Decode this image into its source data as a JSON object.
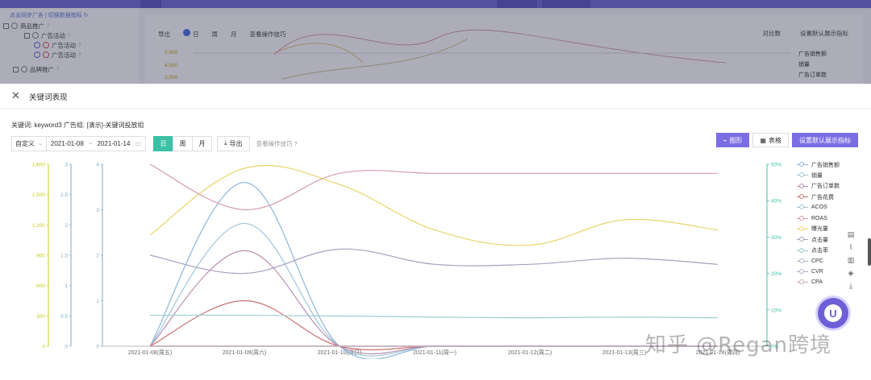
{
  "background": {
    "left_hint": "点击同步广告 | 切换数据指标 ↻",
    "tree": [
      {
        "label": "商品推广",
        "indent": 0
      },
      {
        "label": "广告活动",
        "indent": 1
      },
      {
        "label": "广告活动",
        "indent": 2
      },
      {
        "label": "广告活动",
        "indent": 2
      },
      {
        "label": "品牌推广",
        "indent": 0
      }
    ],
    "tools": {
      "export": "导出",
      "day": "日",
      "week": "周",
      "month": "月",
      "tip": "查看操作技巧"
    },
    "right": {
      "compare": "对比数",
      "set_default": "设置默认展示指标"
    },
    "legend": [
      "广告销售额",
      "销量",
      "广告订单数"
    ],
    "y_values": [
      "5,000",
      "4,000",
      "3,000"
    ]
  },
  "modal": {
    "title": "关键词表现",
    "subtitle": "关键词: keyword3  广告组: [演示]-关键词投放组",
    "range_preset": "自定义",
    "date_start": "2021-01-08",
    "date_sep": "~",
    "date_end": "2021-01-14",
    "seg_day": "日",
    "seg_week": "周",
    "seg_month": "月",
    "export": "导出",
    "op_tip": "查看操作技巧",
    "btn_graph": "图形",
    "btn_table": "表格",
    "btn_set_default": "设置默认展示指标"
  },
  "chart_data": {
    "type": "line",
    "x": [
      "2021-01-08(周五)",
      "2021-01-09(周六)",
      "2021-01-10(周日)",
      "2021-01-11(周一)",
      "2021-01-12(周二)",
      "2021-01-13(周三)",
      "2021-01-14(周四)"
    ],
    "y_axes": [
      {
        "ticks": [
          "0",
          "300",
          "600",
          "900",
          "1,200",
          "1,500",
          "1,800"
        ],
        "color": "#c5cf1e"
      },
      {
        "ticks": [
          "0",
          "0.5",
          "1",
          "1.5",
          "2",
          "2.5",
          "3"
        ],
        "color": "#7fa8c9"
      },
      {
        "ticks": [
          "0",
          "1",
          "2",
          "3",
          "4"
        ],
        "color": "#7fa8c9"
      },
      {
        "ticks": [
          "0%",
          "10%",
          "20%",
          "30%",
          "40%",
          "50%"
        ],
        "color": "#3cc1a6"
      }
    ],
    "series": [
      {
        "name": "广告销售额",
        "axis": 2,
        "color": "#8fb6d9",
        "values": [
          0,
          3.6,
          0,
          0,
          0,
          0,
          0
        ]
      },
      {
        "name": "销量",
        "axis": 2,
        "color": "#9fc5da",
        "values": [
          0,
          2.7,
          0,
          0,
          0,
          0,
          0
        ]
      },
      {
        "name": "广告订单数",
        "axis": 2,
        "color": "#b68fb0",
        "values": [
          0,
          2.1,
          0,
          0,
          0,
          0,
          0
        ]
      },
      {
        "name": "广告花费",
        "axis": 2,
        "color": "#c97070",
        "values": [
          0,
          1.0,
          0,
          0,
          0,
          0,
          0
        ]
      },
      {
        "name": "ACOS",
        "axis": 3,
        "color": "#9ec0d8",
        "values": [
          0,
          0,
          0,
          0,
          0,
          0,
          0
        ]
      },
      {
        "name": "ROAS",
        "axis": 2,
        "color": "#d29ab0",
        "values": [
          4,
          3.0,
          3.8,
          3.8,
          3.8,
          3.8,
          3.8
        ]
      },
      {
        "name": "曝光量",
        "axis": 0,
        "color": "#e8d56a",
        "values": [
          1100,
          1760,
          1600,
          1150,
          1000,
          1250,
          1150
        ]
      },
      {
        "name": "点击量",
        "axis": 1,
        "color": "#a8a0c0",
        "values": [
          1.5,
          1.2,
          1.6,
          1.35,
          1.35,
          1.45,
          1.35
        ]
      },
      {
        "name": "点击率",
        "axis": 3,
        "color": "#9ecfd5",
        "values": [
          0.085,
          0.085,
          0.083,
          0.08,
          0.078,
          0.08,
          0.078
        ]
      },
      {
        "name": "CPC",
        "axis": 3,
        "color": "#aab3be",
        "values": [
          0,
          0,
          0,
          0,
          0,
          0,
          0
        ]
      },
      {
        "name": "CVR",
        "axis": 3,
        "color": "#b9a8c9",
        "values": [
          0,
          0,
          0,
          0,
          0,
          0,
          0
        ]
      },
      {
        "name": "CPA",
        "axis": 3,
        "color": "#c8a8b8",
        "values": [
          0,
          0,
          0,
          0,
          0,
          0,
          0
        ]
      }
    ],
    "grid": false,
    "legend_position": "right"
  },
  "colors": {
    "accent": "#7b6ee3",
    "active_seg": "#3cc1a6"
  },
  "side_tools": [
    "document-icon",
    "line-chart-icon",
    "bar-chart-icon",
    "layers-icon",
    "download-icon"
  ],
  "watermark": "知乎 @Regan跨境"
}
